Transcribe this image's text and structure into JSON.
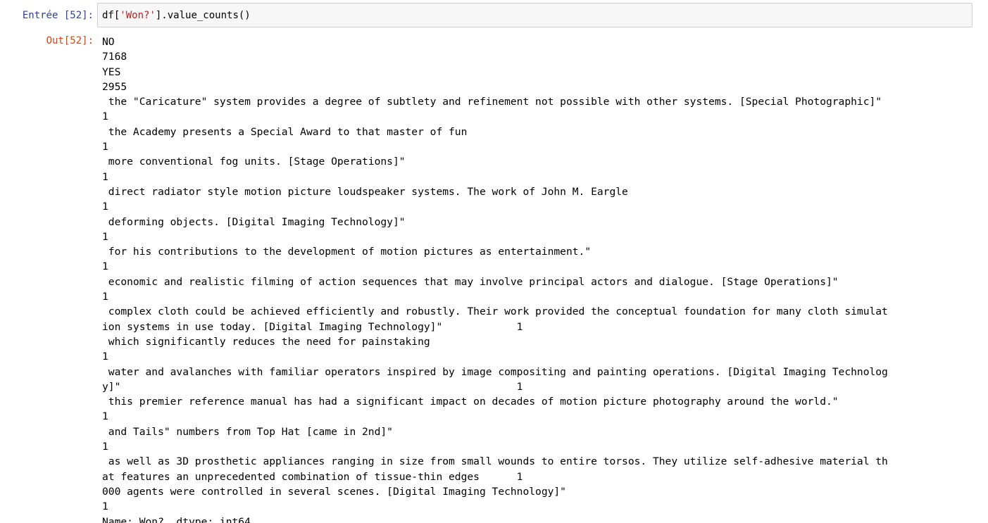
{
  "cell": {
    "in_prompt": "Entrée [52]:",
    "code": {
      "prefix": "df[",
      "string": "'Won?'",
      "suffix": "].value_counts()"
    },
    "out_prompt": "Out[52]:"
  },
  "output_lines": [
    "NO",
    "7168",
    "YES",
    "2955",
    " the \"Caricature\" system provides a degree of subtlety and refinement not possible with other systems. [Special Photographic]\"",
    "1",
    " the Academy presents a Special Award to that master of fun",
    "1",
    " more conventional fog units. [Stage Operations]\"",
    "1",
    " direct radiator style motion picture loudspeaker systems. The work of John M. Eargle",
    "1",
    " deforming objects. [Digital Imaging Technology]\"",
    "1",
    " for his contributions to the development of motion pictures as entertainment.\"",
    "1",
    " economic and realistic filming of action sequences that may involve principal actors and dialogue. [Stage Operations]\"",
    "1",
    " complex cloth could be achieved efficiently and robustly. Their work provided the conceptual foundation for many cloth simulat",
    "ion systems in use today. [Digital Imaging Technology]\"            1",
    " which significantly reduces the need for painstaking",
    "1",
    " water and avalanches with familiar operators inspired by image compositing and painting operations. [Digital Imaging Technolog",
    "y]\"                                                                1",
    " this premier reference manual has had a significant impact on decades of motion picture photography around the world.\"",
    "1",
    " and Tails\" numbers from Top Hat [came in 2nd]\"",
    "1",
    " as well as 3D prosthetic appliances ranging in size from small wounds to entire torsos. They utilize self-adhesive material th",
    "at features an unprecedented combination of tissue-thin edges      1",
    "000 agents were controlled in several scenes. [Digital Imaging Technology]\"",
    "1",
    "Name: Won?, dtype: int64"
  ]
}
